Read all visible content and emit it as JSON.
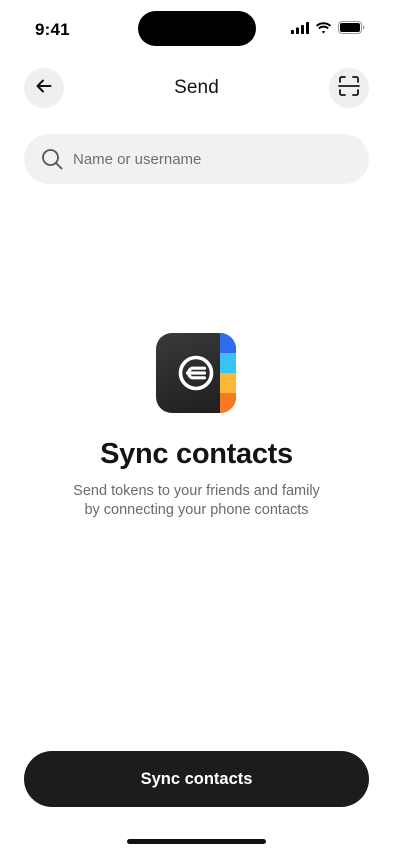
{
  "status_bar": {
    "time": "9:41",
    "icons": [
      "cellular-signal-icon",
      "wifi-icon",
      "battery-icon"
    ]
  },
  "header": {
    "title": "Send",
    "back_icon": "arrow-left-icon",
    "scan_icon": "scan-frame-icon"
  },
  "search": {
    "placeholder": "Name or username",
    "value": "",
    "icon": "search-icon"
  },
  "empty_state": {
    "app_icon": "contacts-app-icon",
    "stripe_colors": [
      "#2f6bf0",
      "#37c4f2",
      "#fbb735",
      "#f57a21"
    ],
    "title": "Sync contacts",
    "subtitle_lines": [
      "Send tokens to your friends and family",
      "by connecting your phone contacts"
    ]
  },
  "primary_button": {
    "label": "Sync contacts"
  },
  "colors": {
    "button_bg": "#1c1c1c",
    "chip_bg": "#efefef",
    "search_bg": "#f1f1f1",
    "muted_text": "#6a6a6a"
  }
}
